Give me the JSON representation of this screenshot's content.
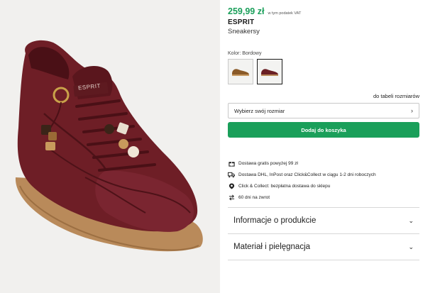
{
  "gallery": {
    "product_image": "burgundy-suede-sneaker",
    "image_logo": "ESPRIT"
  },
  "product": {
    "price": "259,99 zł",
    "vat_note": "w tym podatek VAT",
    "brand": "ESPRIT",
    "name": "Sneakersy",
    "color_label": "Kolor: Bordowy"
  },
  "swatches": [
    {
      "color": "#8a5a28",
      "selected": false
    },
    {
      "color": "#6a1f24",
      "selected": true
    }
  ],
  "size": {
    "table_link": "do tabeli rozmiarów",
    "select_placeholder": "Wybierz swój rozmiar"
  },
  "cart": {
    "add_label": "Dodaj do koszyka"
  },
  "info": [
    {
      "icon": "gift-icon",
      "text": "Dostawa gratis powyżej 99 zł"
    },
    {
      "icon": "truck-icon",
      "text": "Dostawa DHL, InPost oraz Click&Collect w ciągu 1-2 dni roboczych"
    },
    {
      "icon": "store-icon",
      "text": "Click & Collect: bezpłatna dostawa do sklepu"
    },
    {
      "icon": "return-icon",
      "text": "60 dni na zwrot"
    }
  ],
  "accordion": [
    {
      "label": "Informacje o produkcie"
    },
    {
      "label": "Materiał i pielęgnacja"
    }
  ],
  "colors": {
    "accent_green": "#1a9f5a",
    "shoe_burgundy": "#6e1e26",
    "sole_gum": "#b98a5a"
  }
}
